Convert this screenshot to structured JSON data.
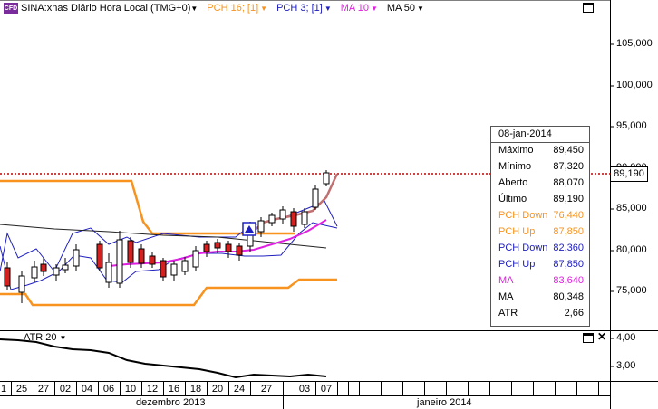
{
  "header": {
    "symbol_title": "SINA:xnas Diário Hora Local (TMG+0)",
    "cfd_badge": "CFD",
    "indicators": [
      {
        "label": "PCH 16; [1]",
        "color": "#f7931e"
      },
      {
        "label": "PCH 3; [1]",
        "color": "#2020c0"
      },
      {
        "label": "MA 10",
        "color": "#e020e0"
      },
      {
        "label": "MA 50",
        "color": "#000000"
      }
    ]
  },
  "price_axis": {
    "labels": [
      "105,000",
      "100,000",
      "95,000",
      "90,000",
      "85,000",
      "80,000",
      "75,000"
    ],
    "current_price_tag": "89,190"
  },
  "info_box": {
    "date": "08-jan-2014",
    "rows": [
      {
        "label": "Máximo",
        "value": "89,450",
        "color": "#000000"
      },
      {
        "label": "Mínimo",
        "value": "87,320",
        "color": "#000000"
      },
      {
        "label": "Aberto",
        "value": "88,070",
        "color": "#000000"
      },
      {
        "label": "Último",
        "value": "89,190",
        "color": "#000000"
      },
      {
        "label": "PCH Down",
        "value": "76,440",
        "color": "#f7931e"
      },
      {
        "label": "PCH Up",
        "value": "87,850",
        "color": "#f7931e"
      },
      {
        "label": "PCH Down",
        "value": "82,360",
        "color": "#2020c0"
      },
      {
        "label": "PCH Up",
        "value": "87,850",
        "color": "#2020c0"
      },
      {
        "label": "MA",
        "value": "83,640",
        "color": "#e020e0"
      },
      {
        "label": "MA",
        "value": "80,348",
        "color": "#000000"
      },
      {
        "label": "ATR",
        "value": "2,66",
        "color": "#000000"
      }
    ]
  },
  "atr_panel": {
    "label": "ATR 20",
    "axis_labels": [
      "4,00",
      "3,00"
    ]
  },
  "x_axis": {
    "day_labels": [
      "1",
      "25",
      "27",
      "02",
      "04",
      "06",
      "10",
      "12",
      "16",
      "18",
      "20",
      "24",
      "27",
      "03",
      "07"
    ],
    "month_labels": [
      "dezembro 2013",
      "janeiro 2014"
    ]
  },
  "colors": {
    "pch16": "#f7931e",
    "pch3": "#2020c0",
    "ma10": "#e020e0",
    "ma50": "#000000",
    "bull_candle": "#ffffff",
    "bear_candle": "#d62020",
    "price_line": "#c00000"
  }
}
